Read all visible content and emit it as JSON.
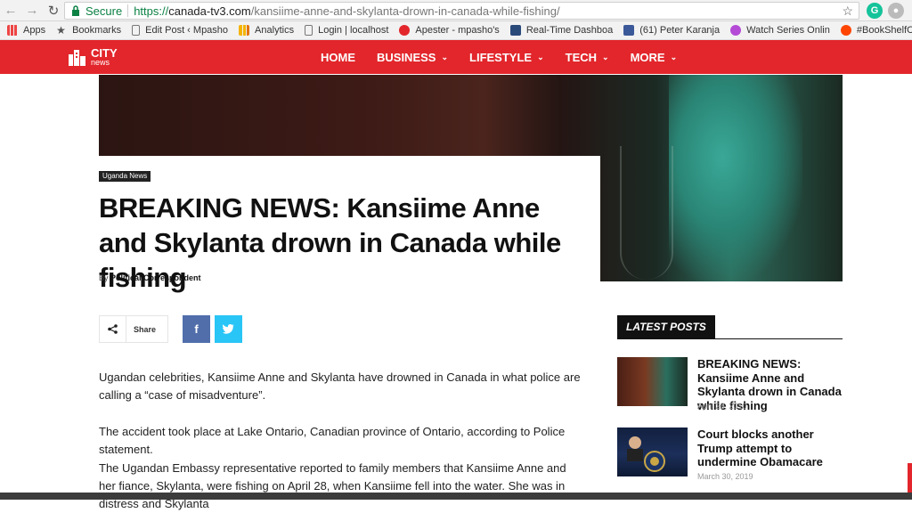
{
  "browser": {
    "secure_label": "Secure",
    "url_proto": "https://",
    "url_host": "canada-tv3.com",
    "url_path": "/kansiime-anne-and-skylanta-drown-in-canada-while-fishing/"
  },
  "bookmarks": [
    {
      "label": "Apps",
      "icon": "apps-grid-icon"
    },
    {
      "label": "Bookmarks",
      "icon": "star-icon"
    },
    {
      "label": "Edit Post ‹ Mpasho",
      "icon": "page-icon"
    },
    {
      "label": "Analytics",
      "icon": "analytics-icon"
    },
    {
      "label": "Login | localhost",
      "icon": "page-icon"
    },
    {
      "label": "Apester - mpasho's",
      "icon": "apester-icon"
    },
    {
      "label": "Real-Time Dashboa",
      "icon": "dashboard-icon"
    },
    {
      "label": "(61) Peter Karanja",
      "icon": "facebook-icon"
    },
    {
      "label": "Watch Series Onlin",
      "icon": "play-icon"
    },
    {
      "label": "#BookShelfChallen",
      "icon": "reddit-icon"
    }
  ],
  "site": {
    "logo_city": "CITY",
    "logo_news": "news",
    "menu": [
      {
        "label": "HOME",
        "dropdown": false
      },
      {
        "label": "BUSINESS",
        "dropdown": true
      },
      {
        "label": "LIFESTYLE",
        "dropdown": true
      },
      {
        "label": "TECH",
        "dropdown": true
      },
      {
        "label": "MORE",
        "dropdown": true
      }
    ],
    "accent": "#e2262b"
  },
  "article": {
    "category": "Uganda News",
    "title": "BREAKING NEWS: Kansiime Anne and Skylanta drown in Canada while fishing",
    "by": "By",
    "author": "Political Correspondent",
    "share_label": "Share",
    "paragraphs": [
      "Ugandan celebrities, Kansiime Anne and Skylanta have drowned in Canada in what police are calling a “case of misadventure”.",
      "The accident took place at Lake Ontario, Canadian province of Ontario, according to Police statement.",
      "The Ugandan Embassy representative reported to family members that Kansiime Anne and her fiance, Skylanta, were fishing on April 28, when Kansiime fell into the water. She was in distress and Skylanta"
    ]
  },
  "sidebar": {
    "heading": "LATEST POSTS",
    "posts": [
      {
        "title": "BREAKING NEWS: Kansiime Anne and Skylanta drown in Canada while fishing",
        "date": "April 28, 2010"
      },
      {
        "title": "Court blocks another Trump attempt to undermine Obamacare",
        "date": "March 30, 2019"
      }
    ]
  }
}
